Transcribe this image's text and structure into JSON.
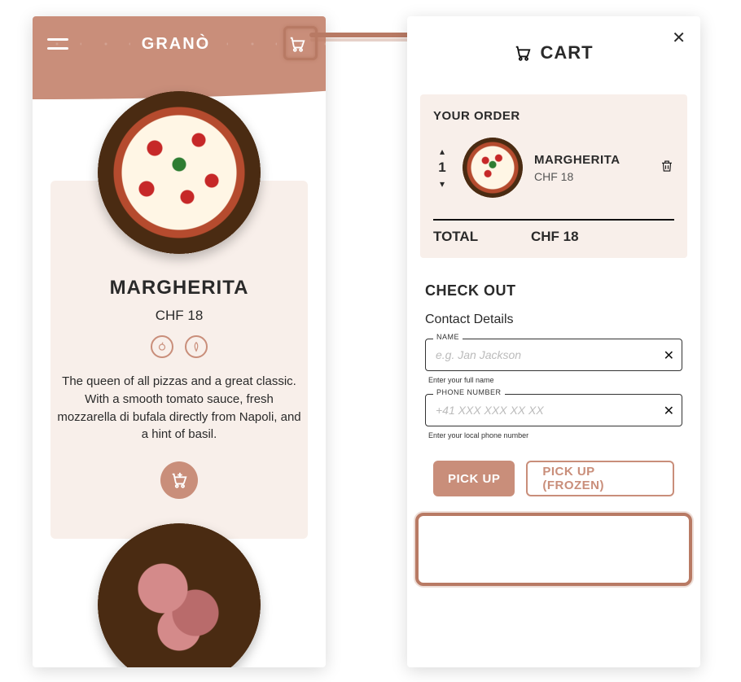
{
  "brand": {
    "name": "GRANÒ"
  },
  "menu": {
    "product": {
      "name": "MARGHERITA",
      "price": "CHF 18",
      "description": "The queen of all pizzas and a great classic. With a smooth tomato sauce, fresh mozzarella di bufala directly from Napoli, and a hint of basil."
    }
  },
  "cart": {
    "title": "CART",
    "order_label": "YOUR ORDER",
    "items": [
      {
        "qty": "1",
        "name": "MARGHERITA",
        "price": "CHF 18"
      }
    ],
    "total_label": "TOTAL",
    "total_value": "CHF 18"
  },
  "checkout": {
    "heading": "CHECK OUT",
    "contact_heading": "Contact Details",
    "fields": {
      "name": {
        "label": "NAME",
        "placeholder": "e.g. Jan Jackson",
        "hint": "Enter your full name"
      },
      "phone": {
        "label": "PHONE NUMBER",
        "placeholder": "+41 XXX XXX XX XX",
        "hint": "Enter your local phone number"
      }
    },
    "buttons": {
      "pickup": "PICK UP",
      "pickup_frozen": "PICK UP (FROZEN)"
    }
  }
}
